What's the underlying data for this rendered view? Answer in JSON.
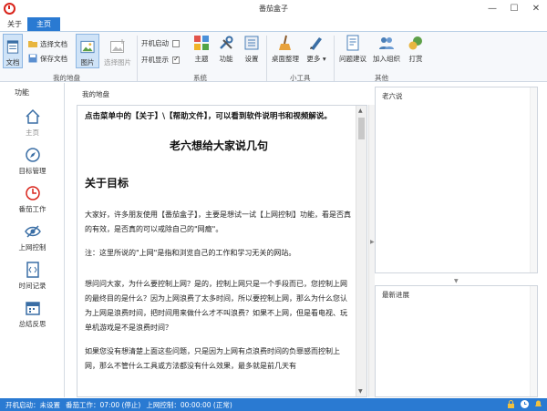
{
  "window": {
    "title": "番茄盒子",
    "minimize": "—",
    "maximize": "☐",
    "close": "✕"
  },
  "tabs": [
    {
      "label": "关于"
    },
    {
      "label": "主页"
    }
  ],
  "ribbon": {
    "doc": "文档",
    "select_doc": "选择文档",
    "save_doc": "保存文档",
    "image": "图片",
    "select_image": "选择图片",
    "group_my_space": "我的地盘",
    "boot_start": "开机启动",
    "boot_show": "开机显示",
    "theme": "主题",
    "features": "功能",
    "settings": "设置",
    "group_system": "系统",
    "desktop_clean": "桌面整理",
    "more": "更多",
    "group_tools": "小工具",
    "feedback": "问题建议",
    "join_group": "加入组织",
    "donate": "打赏",
    "group_other": "其他",
    "dropdown_glyph": "▾"
  },
  "nav": {
    "title": "功能",
    "items": [
      {
        "label": "主页"
      },
      {
        "label": "目标管理"
      },
      {
        "label": "番茄工作"
      },
      {
        "label": "上网控制"
      },
      {
        "label": "时间记录"
      },
      {
        "label": "总结反思"
      }
    ]
  },
  "main": {
    "header": "我的地盘",
    "notice": "点击菜单中的【关于】\\【帮助文件】，可以看到软件说明书和视频解说。",
    "title": "老六想给大家说几句",
    "h2": "关于目标",
    "p1": "大家好，许多朋友使用【番茄盒子】，主要是想试一试【上网控制】功能，看是否真的有效，是否真的可以戒除自己的\"网瘾\"。",
    "p2": "注：这里所说的\"上网\"是指和浏览自己的工作和学习无关的网站。",
    "p3": "想问问大家，为什么要控制上网？是的，控制上网只是一个手段而已，您控制上网的最终目的是什么？因为上网浪费了太多时间，所以要控制上网，那么为什么您认为上网是浪费时间，把时间用来做什么才不叫浪费？如果不上网，但是看电视、玩单机游戏是不是浪费时间？",
    "p4": "如果您没有想清楚上面这些问题，只是因为上网有点浪费时间的负罪感而控制上网，那么不管什么工具或方法都没有什么效果，最多就是前几天有"
  },
  "right": {
    "top_title": "老六说",
    "bottom_title": "最新进展"
  },
  "status": {
    "boot": "开机启动：未设置",
    "pomodoro": "番茄工作：07:00 (停止)",
    "net": "上网控制：00:00:00 (正常)"
  },
  "colors": {
    "accent": "#2a7ad2",
    "logo_red": "#d9241b"
  }
}
